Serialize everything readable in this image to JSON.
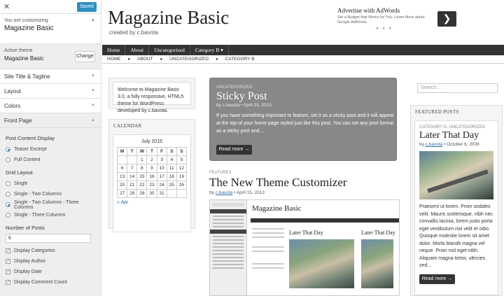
{
  "customizer": {
    "saved_label": "Saved",
    "customizing_label": "You are customizing",
    "site_name": "Magazine Basic",
    "active_theme_label": "Active theme",
    "active_theme_name": "Magazine Basic",
    "change_label": "Change",
    "sections": [
      "Site Title & Tagline",
      "Layout",
      "Colors"
    ],
    "open_section": "Front Page",
    "post_content_display": {
      "title": "Post Content Display",
      "options": [
        "Teaser Excerpt",
        "Full Content"
      ],
      "selected": 0
    },
    "grid_layout": {
      "title": "Grid Layout",
      "options": [
        "Single",
        "Single - Two Columns",
        "Single - Two Columns - Three Columns",
        "Single - Three Columns"
      ],
      "selected": 2
    },
    "number_of_posts": {
      "title": "Number of Posts",
      "value": "6"
    },
    "checkboxes": [
      "Display Categories",
      "Display Author",
      "Display Date",
      "Display Comment Count"
    ]
  },
  "preview": {
    "site_title": "Magazine Basic",
    "tagline": "created by c.bavota",
    "ad": {
      "heading": "Advertise with AdWords",
      "text": "Set a Budget that Works for You. Learn More about Google AdWords.",
      "dots": "● ● ●",
      "arrow": "❯"
    },
    "nav": [
      "Home",
      "About",
      "Uncategorized",
      "Category B"
    ],
    "nav_dropdown": "▾",
    "subnav": [
      "HOME",
      "ABOUT",
      "UNCATEGORIZED",
      "CATEGORY B"
    ],
    "welcome": "Welcome to Magazine Basic 3.0, a fully responsive, HTML5 theme for WordPress developed by c.bavota.",
    "calendar": {
      "heading": "CALENDAR",
      "month": "July 2015",
      "days": [
        "M",
        "T",
        "W",
        "T",
        "F",
        "S",
        "S"
      ],
      "weeks": [
        [
          "",
          "",
          "1",
          "2",
          "3",
          "4",
          "5"
        ],
        [
          "6",
          "7",
          "8",
          "9",
          "10",
          "11",
          "12"
        ],
        [
          "13",
          "14",
          "15",
          "16",
          "17",
          "18",
          "19"
        ],
        [
          "20",
          "21",
          "22",
          "23",
          "24",
          "25",
          "26"
        ],
        [
          "27",
          "28",
          "29",
          "30",
          "31",
          "",
          ""
        ]
      ],
      "prev": "« Apr"
    },
    "sticky": {
      "category": "UNCATEGORIZED",
      "title": "Sticky Post",
      "meta": "by c.bavota • April 15, 2013",
      "excerpt": "If you have something important to feature, set it as a sticky post and it will appear at the top of your home page styled just like this post. You can set any post format as a sticky post and…",
      "more": "Read more →"
    },
    "featured_post": {
      "category": "FEATURES",
      "title": "The New Theme Customizer",
      "by": "by",
      "author": "c.bavota",
      "date": "• April 15, 2013"
    },
    "screenshot": {
      "title": "Magazine Basic",
      "post_title": "Later That Day",
      "post_title2": "Later That Day"
    },
    "search_placeholder": "Search…",
    "featured_posts_widget": {
      "heading": "FEATURED POSTS",
      "category": "CATEGORY D, UNCATEGORIZED",
      "title": "Later That Day",
      "by": "by",
      "author": "c.bavota",
      "date": "• October 6, 2008",
      "excerpt": "Praesent ut lorem. Proin sodales velit. Mauris scelerisque, nibh nec convallis lacinia, lorem justo porta eget vestibulum nisi velit et odio. Quisque molestie lorem sit amet dolor. Morbi blandit magna vel neque. Proin nisl eget nibh. Aliquam magna tortor, ultricies sed...",
      "more": "Read more →"
    }
  }
}
